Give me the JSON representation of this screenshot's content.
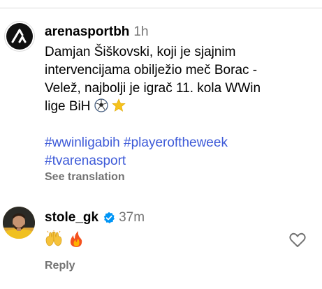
{
  "post": {
    "username": "arenasportbh",
    "time": "1h",
    "caption": "Damjan Šiškovski, koji je sjajnim intervencijama obilježio meč Borac - Velež, najbolji je igrač 11. kola WWin lige BiH",
    "caption_emoji": [
      "soccer-ball",
      "star"
    ],
    "hashtags": [
      "#wwinligabih",
      "#playeroftheweek",
      "#tvarenasport"
    ],
    "see_translation": "See translation"
  },
  "comment": {
    "username": "stole_gk",
    "verified": true,
    "time": "37m",
    "emoji": [
      "raising-hands",
      "fire"
    ],
    "reply_label": "Reply"
  },
  "colors": {
    "hashtag": "#3d5ad8",
    "muted": "#737373",
    "verified": "#0095f6",
    "border": "#dbdbdb"
  }
}
